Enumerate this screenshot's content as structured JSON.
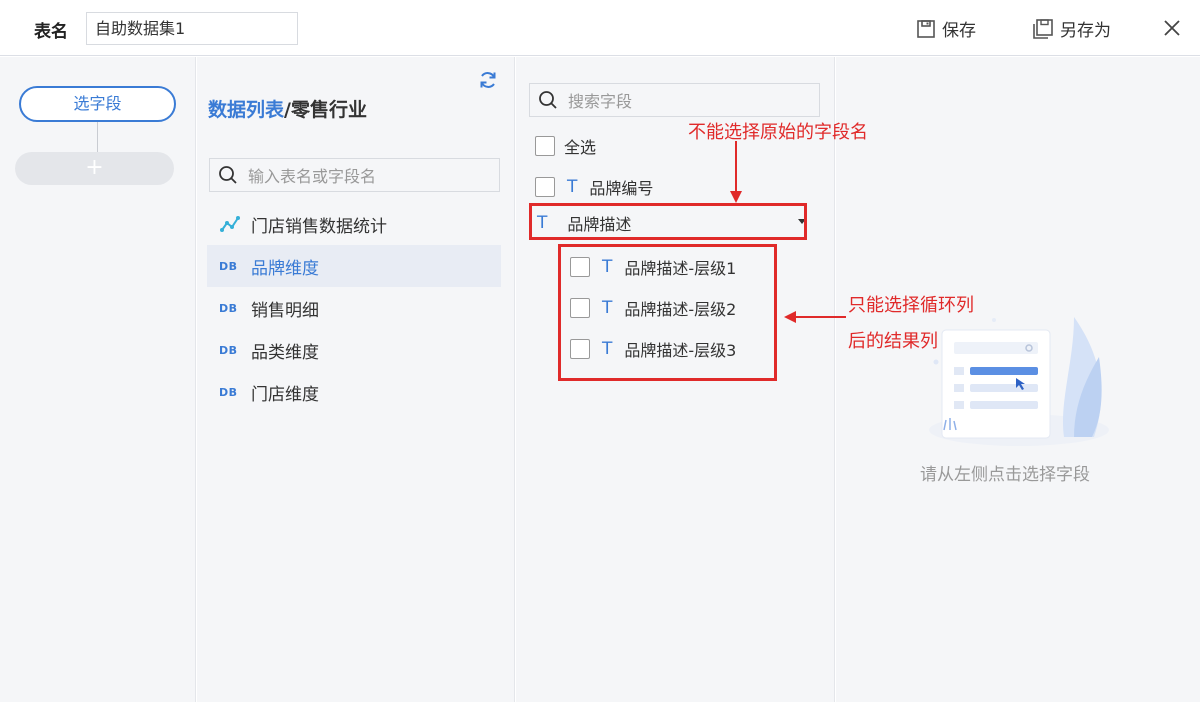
{
  "header": {
    "table_name_label": "表名",
    "table_name_value": "自助数据集1",
    "save_label": "保存",
    "save_as_label": "另存为"
  },
  "steps": {
    "current_step": "选字段",
    "add_symbol": "+"
  },
  "data_list": {
    "title_prefix": "数据列表",
    "title_suffix": "/零售行业",
    "search_placeholder": "输入表名或字段名",
    "items": [
      {
        "label": "门店销售数据统计",
        "icon": "analysis-icon"
      },
      {
        "label": "品牌维度",
        "icon": "db-icon",
        "selected": true
      },
      {
        "label": "销售明细",
        "icon": "db-icon"
      },
      {
        "label": "品类维度",
        "icon": "db-icon"
      },
      {
        "label": "门店维度",
        "icon": "db-icon"
      }
    ]
  },
  "fields": {
    "search_placeholder": "搜索字段",
    "select_all": "全选",
    "type_symbol": "T",
    "field_1": "品牌编号",
    "group_field": "品牌描述",
    "sub_fields": [
      "品牌描述-层级1",
      "品牌描述-层级2",
      "品牌描述-层级3"
    ]
  },
  "preview": {
    "empty_text": "请从左侧点击选择字段"
  },
  "annotations": {
    "top_note": "不能选择原始的字段名",
    "side_note_line1": "只能选择循环列",
    "side_note_line2": "后的结果列",
    "color": "#e02a2a"
  },
  "colors": {
    "accent": "#3a7bd5",
    "panel_bg": "#f5f6f8"
  }
}
